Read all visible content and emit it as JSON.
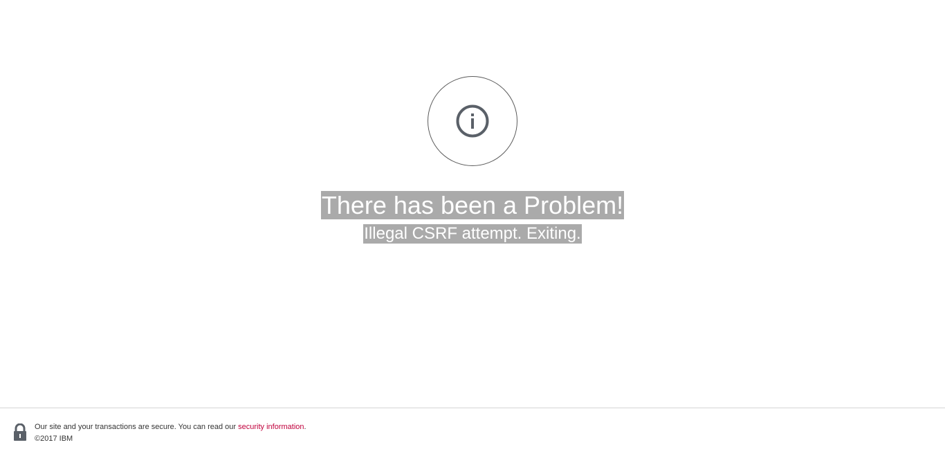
{
  "error": {
    "icon": "info-icon",
    "title": "There has been a Problem!",
    "message": "Illegal CSRF attempt. Exiting."
  },
  "footer": {
    "icon": "lock-icon",
    "secure_text": "Our site and your transactions are secure. You can read our ",
    "link_label": "security information",
    "trailing": ".",
    "copyright": "©2017 IBM"
  },
  "colors": {
    "highlight_bg": "#aaaaaa",
    "link": "#c0003c",
    "icon": "#5a6068"
  }
}
